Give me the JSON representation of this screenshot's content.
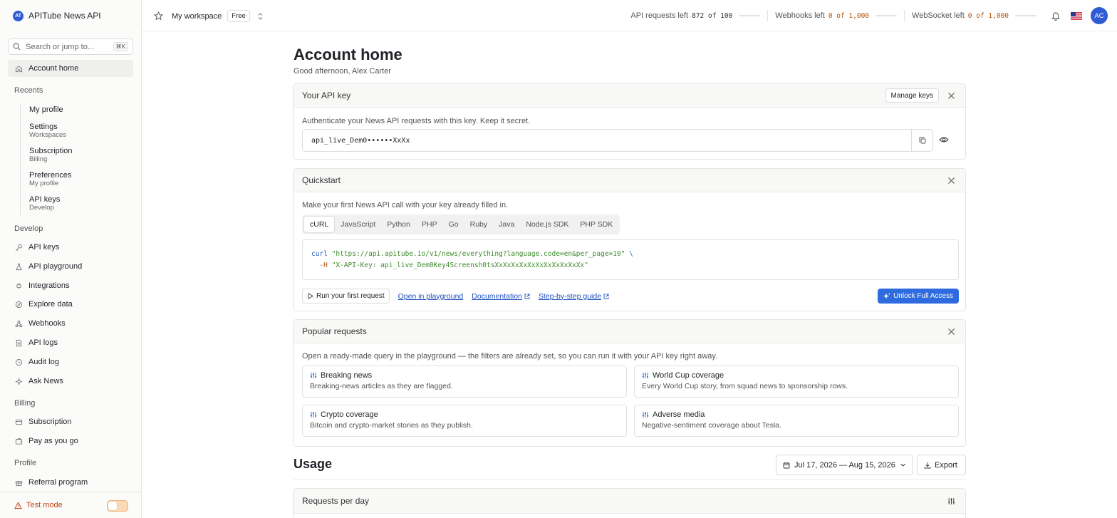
{
  "brand": {
    "name": "APITube News API",
    "logo_text": "AT"
  },
  "search": {
    "placeholder": "Search or jump to...",
    "shortcut": "⌘K"
  },
  "nav": {
    "home": "Account home",
    "recents_heading": "Recents",
    "recents": [
      {
        "label": "My profile",
        "sub": ""
      },
      {
        "label": "Settings",
        "sub": "Workspaces"
      },
      {
        "label": "Subscription",
        "sub": "Billing"
      },
      {
        "label": "Preferences",
        "sub": "My profile"
      },
      {
        "label": "API keys",
        "sub": "Develop"
      }
    ],
    "develop_heading": "Develop",
    "develop": [
      "API keys",
      "API playground",
      "Integrations",
      "Explore data",
      "Webhooks",
      "API logs",
      "Audit log",
      "Ask News"
    ],
    "billing_heading": "Billing",
    "billing": [
      "Subscription",
      "Pay as you go"
    ],
    "profile_heading": "Profile",
    "profile": [
      "Referral program"
    ],
    "test_mode": "Test mode"
  },
  "topbar": {
    "workspace": "My workspace",
    "plan": "Free",
    "quotas": [
      {
        "label": "API requests left",
        "value": "872 of 100",
        "warn": false
      },
      {
        "label": "Webhooks left",
        "value": "0 of 1,000",
        "warn": true
      },
      {
        "label": "WebSocket left",
        "value": "0 of 1,000",
        "warn": true
      }
    ],
    "avatar": "AC"
  },
  "page": {
    "title": "Account home",
    "greeting": "Good afternoon, Alex Carter"
  },
  "api_key": {
    "title": "Your API key",
    "manage": "Manage keys",
    "description": "Authenticate your News API requests with this key. Keep it secret.",
    "value": "api_live_Dem0••••••XxXx"
  },
  "quickstart": {
    "title": "Quickstart",
    "description": "Make your first News API call with your key already filled in.",
    "tabs": [
      "cURL",
      "JavaScript",
      "Python",
      "PHP",
      "Go",
      "Ruby",
      "Java",
      "Node.js SDK",
      "PHP SDK"
    ],
    "active_tab": "cURL",
    "code": {
      "cmd": "curl",
      "url": "\"https://api.apitube.io/v1/news/everything?language.code=en&per_page=10\"",
      "cont": " \\",
      "flag": "-H",
      "header": "\"X-API-Key: api_live_Dem0Key4Screensh0tsXxXxXxXxXxXxXxXxXxXxXx\""
    },
    "run": "Run your first request",
    "links": [
      "Open in playground",
      "Documentation",
      "Step-by-step guide"
    ],
    "unlock": "Unlock Full Access"
  },
  "popular": {
    "title": "Popular requests",
    "description": "Open a ready-made query in the playground — the filters are already set, so you can run it with your API key right away.",
    "items": [
      {
        "title": "Breaking news",
        "desc": "Breaking-news articles as they are flagged."
      },
      {
        "title": "World Cup coverage",
        "desc": "Every World Cup story, from squad news to sponsorship rows."
      },
      {
        "title": "Crypto coverage",
        "desc": "Bitcoin and crypto-market stories as they publish."
      },
      {
        "title": "Adverse media",
        "desc": "Negative-sentiment coverage about Tesla."
      }
    ]
  },
  "usage": {
    "title": "Usage",
    "date_range": "Jul 17, 2026 — Aug 15, 2026",
    "export": "Export",
    "requests_per_day": "Requests per day"
  },
  "colors": {
    "accent": "#2d6bdf",
    "brand": "#2f5bd3",
    "warn": "#b45309",
    "test_mode": "#c2410c"
  }
}
